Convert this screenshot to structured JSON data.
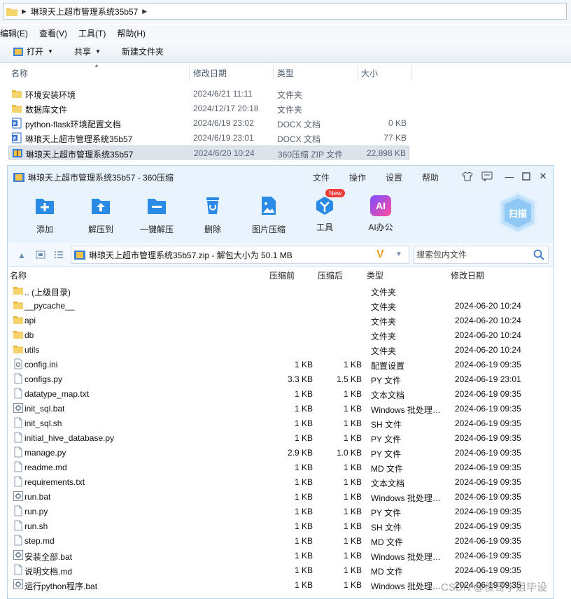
{
  "explorer": {
    "breadcrumb": "琳琅天上超市管理系统35b57",
    "menu": [
      "编辑(E)",
      "查看(V)",
      "工具(T)",
      "帮助(H)"
    ],
    "toolbar": {
      "open": "打开",
      "share": "共享",
      "new_folder": "新建文件夹"
    },
    "columns": {
      "name": "名称",
      "date": "修改日期",
      "type": "类型",
      "size": "大小"
    },
    "rows": [
      {
        "name": "环境安装环境",
        "date": "2024/6/21 11:11",
        "type": "文件夹",
        "size": "",
        "icon": "folder-icon"
      },
      {
        "name": "数据库文件",
        "date": "2024/12/17 20:18",
        "type": "文件夹",
        "size": "",
        "icon": "folder-icon"
      },
      {
        "name": "python-flask环境配置文档",
        "date": "2024/6/19 23:02",
        "type": "DOCX 文档",
        "size": "0 KB",
        "icon": "word-doc-icon"
      },
      {
        "name": "琳琅天上超市管理系统35b57",
        "date": "2024/6/19 23:01",
        "type": "DOCX 文档",
        "size": "77 KB",
        "icon": "word-doc-icon"
      },
      {
        "name": "琳琅天上超市管理系统35b57",
        "date": "2024/6/20 10:24",
        "type": "360压缩 ZIP 文件",
        "size": "22,898 KB",
        "icon": "zip-archive-icon",
        "selected": true
      }
    ]
  },
  "zip": {
    "title": "琳琅天上超市管理系统35b57 - 360压缩",
    "menu": [
      "文件",
      "操作",
      "设置",
      "帮助"
    ],
    "tools": [
      {
        "label": "添加",
        "icon": "add-icon"
      },
      {
        "label": "解压到",
        "icon": "extract-to-icon"
      },
      {
        "label": "一键解压",
        "icon": "one-click-extract-icon"
      },
      {
        "label": "删除",
        "icon": "delete-icon"
      },
      {
        "label": "图片压缩",
        "icon": "image-compress-icon"
      },
      {
        "label": "工具",
        "icon": "tools-icon",
        "badge": "New"
      },
      {
        "label": "AI办公",
        "icon": "ai-office-icon",
        "icon_text": "AI"
      }
    ],
    "scan_label": "扫描",
    "path": "琳琅天上超市管理系统35b57.zip - 解包大小为 50.1 MB",
    "search_placeholder": "搜索包内文件",
    "columns": {
      "name": "名称",
      "pre": "压缩前",
      "post": "压缩后",
      "type": "类型",
      "date": "修改日期"
    },
    "rows": [
      {
        "name": ".. (上级目录)",
        "pre": "",
        "post": "",
        "type": "文件夹",
        "date": "",
        "icon": "folder-icon"
      },
      {
        "name": "__pycache__",
        "pre": "",
        "post": "",
        "type": "文件夹",
        "date": "2024-06-20 10:24",
        "icon": "folder-icon"
      },
      {
        "name": "api",
        "pre": "",
        "post": "",
        "type": "文件夹",
        "date": "2024-06-20 10:24",
        "icon": "folder-icon"
      },
      {
        "name": "db",
        "pre": "",
        "post": "",
        "type": "文件夹",
        "date": "2024-06-20 10:24",
        "icon": "folder-icon"
      },
      {
        "name": "utils",
        "pre": "",
        "post": "",
        "type": "文件夹",
        "date": "2024-06-20 10:24",
        "icon": "folder-icon"
      },
      {
        "name": "config.ini",
        "pre": "1 KB",
        "post": "1 KB",
        "type": "配置设置",
        "date": "2024-06-19 09:35",
        "icon": "settings-file-icon"
      },
      {
        "name": "configs.py",
        "pre": "3.3 KB",
        "post": "1.5 KB",
        "type": "PY 文件",
        "date": "2024-06-19 23:01",
        "icon": "file-icon"
      },
      {
        "name": "datatype_map.txt",
        "pre": "1 KB",
        "post": "1 KB",
        "type": "文本文档",
        "date": "2024-06-19 09:35",
        "icon": "file-icon"
      },
      {
        "name": "init_sql.bat",
        "pre": "1 KB",
        "post": "1 KB",
        "type": "Windows 批处理文件",
        "date": "2024-06-19 09:35",
        "icon": "batch-file-icon"
      },
      {
        "name": "init_sql.sh",
        "pre": "1 KB",
        "post": "1 KB",
        "type": "SH 文件",
        "date": "2024-06-19 09:35",
        "icon": "file-icon"
      },
      {
        "name": "initial_hive_database.py",
        "pre": "1 KB",
        "post": "1 KB",
        "type": "PY 文件",
        "date": "2024-06-19 09:35",
        "icon": "file-icon"
      },
      {
        "name": "manage.py",
        "pre": "2.9 KB",
        "post": "1.0 KB",
        "type": "PY 文件",
        "date": "2024-06-19 09:35",
        "icon": "file-icon"
      },
      {
        "name": "readme.md",
        "pre": "1 KB",
        "post": "1 KB",
        "type": "MD 文件",
        "date": "2024-06-19 09:35",
        "icon": "file-icon"
      },
      {
        "name": "requirements.txt",
        "pre": "1 KB",
        "post": "1 KB",
        "type": "文本文档",
        "date": "2024-06-19 09:35",
        "icon": "file-icon"
      },
      {
        "name": "run.bat",
        "pre": "1 KB",
        "post": "1 KB",
        "type": "Windows 批处理文件",
        "date": "2024-06-19 09:35",
        "icon": "batch-file-icon"
      },
      {
        "name": "run.py",
        "pre": "1 KB",
        "post": "1 KB",
        "type": "PY 文件",
        "date": "2024-06-19 09:35",
        "icon": "file-icon"
      },
      {
        "name": "run.sh",
        "pre": "1 KB",
        "post": "1 KB",
        "type": "SH 文件",
        "date": "2024-06-19 09:35",
        "icon": "file-icon"
      },
      {
        "name": "step.md",
        "pre": "1 KB",
        "post": "1 KB",
        "type": "MD 文件",
        "date": "2024-06-19 09:35",
        "icon": "file-icon"
      },
      {
        "name": "安装全部.bat",
        "pre": "1 KB",
        "post": "1 KB",
        "type": "Windows 批处理文件",
        "date": "2024-06-19 09:35",
        "icon": "batch-file-icon"
      },
      {
        "name": "说明文档.md",
        "pre": "1 KB",
        "post": "1 KB",
        "type": "MD 文件",
        "date": "2024-06-19 09:35",
        "icon": "file-icon"
      },
      {
        "name": "运行python程序.bat",
        "pre": "1 KB",
        "post": "1 KB",
        "type": "Windows 批处理文件",
        "date": "2024-06-19 09:35",
        "icon": "batch-file-icon"
      }
    ]
  },
  "watermark": "CSDN @俊哥学姐毕设",
  "colors": {
    "folder": "#f2c24b",
    "accent_blue": "#2a8ae6",
    "selection": "#dde3ea",
    "zip_bg": "#e9f3fd"
  }
}
